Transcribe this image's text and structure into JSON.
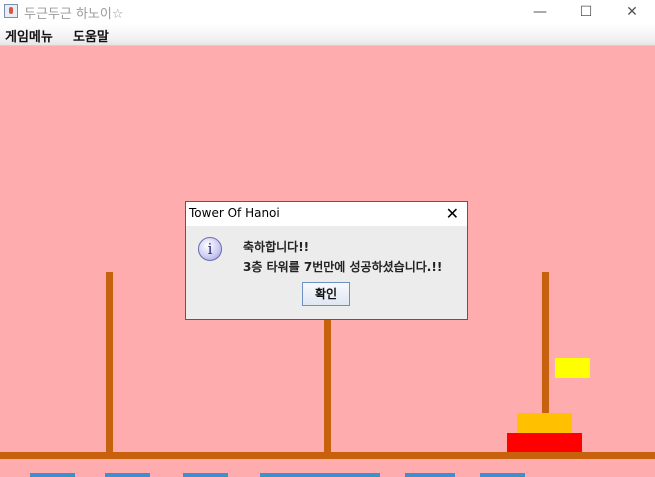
{
  "window": {
    "title": "두근두근 하노이☆",
    "icon": "java-cup-icon",
    "controls": [
      "minimize-icon",
      "maximize-icon",
      "close-icon"
    ],
    "control_glyphs": [
      "—",
      "☐",
      "✕"
    ]
  },
  "menu": {
    "items": [
      {
        "label": "게임메뉴"
      },
      {
        "label": "도움말"
      }
    ]
  },
  "game": {
    "background_color": "#ffacae",
    "pole_color": "#c8610e",
    "tower_levels": 3,
    "move_count": 7,
    "disks": [
      {
        "color": "#ff0000",
        "size": "large",
        "peg": 3
      },
      {
        "color": "#ffc000",
        "size": "medium",
        "peg": 3
      },
      {
        "color": "#ffff00",
        "size": "small",
        "peg": 3
      }
    ]
  },
  "dialog": {
    "title": "Tower Of Hanoi",
    "icon": "info-icon",
    "icon_glyph": "i",
    "close_glyph": "✕",
    "message_line1": "축하합니다!!",
    "message_line2": "3층 타워를 7번만에 성공하셨습니다.!!",
    "ok_label": "확인"
  }
}
